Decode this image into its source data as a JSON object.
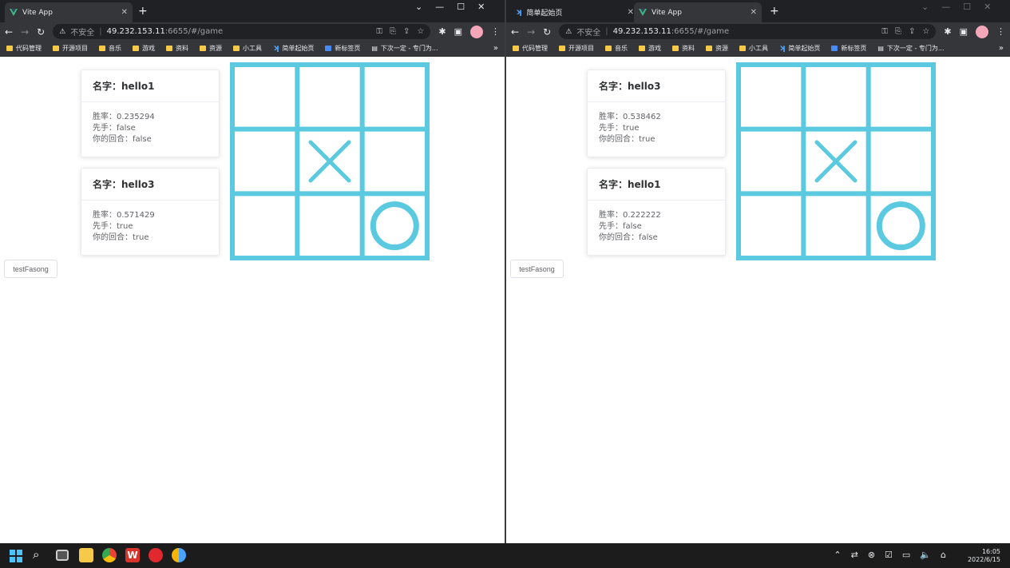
{
  "windows": [
    {
      "tabs": [
        {
          "title": "Vite App",
          "icon": "vue-icon",
          "active": true
        }
      ],
      "address": {
        "insecure_label": "不安全",
        "host": "49.232.153.11",
        "path": ":6655/#/game"
      },
      "bookmarks": [
        "代码管理",
        "开源项目",
        "音乐",
        "游戏",
        "资料",
        "资源",
        "小工具",
        "简单起始页",
        "新标签页",
        "下次一定 - 专门为..."
      ],
      "cards": [
        {
          "title": "名字：hello1",
          "lines": [
            "胜率：0.235294",
            "先手：false",
            "你的回合：false"
          ]
        },
        {
          "title": "名字：hello3",
          "lines": [
            "胜率：0.571429",
            "先手：true",
            "你的回合：true"
          ]
        }
      ],
      "board": [
        "",
        "",
        "",
        "",
        "X",
        "",
        "",
        "",
        "O"
      ],
      "test_button": "testFasong"
    },
    {
      "tabs": [
        {
          "title": "简单起始页",
          "icon": "kite-icon",
          "active": false
        },
        {
          "title": "Vite App",
          "icon": "vue-icon",
          "active": true
        }
      ],
      "address": {
        "insecure_label": "不安全",
        "host": "49.232.153.11",
        "path": ":6655/#/game"
      },
      "bookmarks": [
        "代码管理",
        "开源项目",
        "音乐",
        "游戏",
        "资料",
        "资源",
        "小工具",
        "简单起始页",
        "新标签页",
        "下次一定 - 专门为..."
      ],
      "cards": [
        {
          "title": "名字：hello3",
          "lines": [
            "胜率：0.538462",
            "先手：true",
            "你的回合：true"
          ]
        },
        {
          "title": "名字：hello1",
          "lines": [
            "胜率：0.222222",
            "先手：false",
            "你的回合：false"
          ]
        }
      ],
      "board": [
        "",
        "",
        "",
        "",
        "X",
        "",
        "",
        "",
        "O"
      ],
      "test_button": "testFasong"
    }
  ],
  "board_color": "#5bc9df",
  "taskbar": {
    "apps": [
      "start-icon",
      "search-icon",
      "task-view-icon",
      "file-explorer-icon",
      "chrome-icon",
      "wps-icon",
      "netease-music-icon",
      "paint-icon"
    ],
    "time": "16:05",
    "date": "2022/6/15"
  }
}
